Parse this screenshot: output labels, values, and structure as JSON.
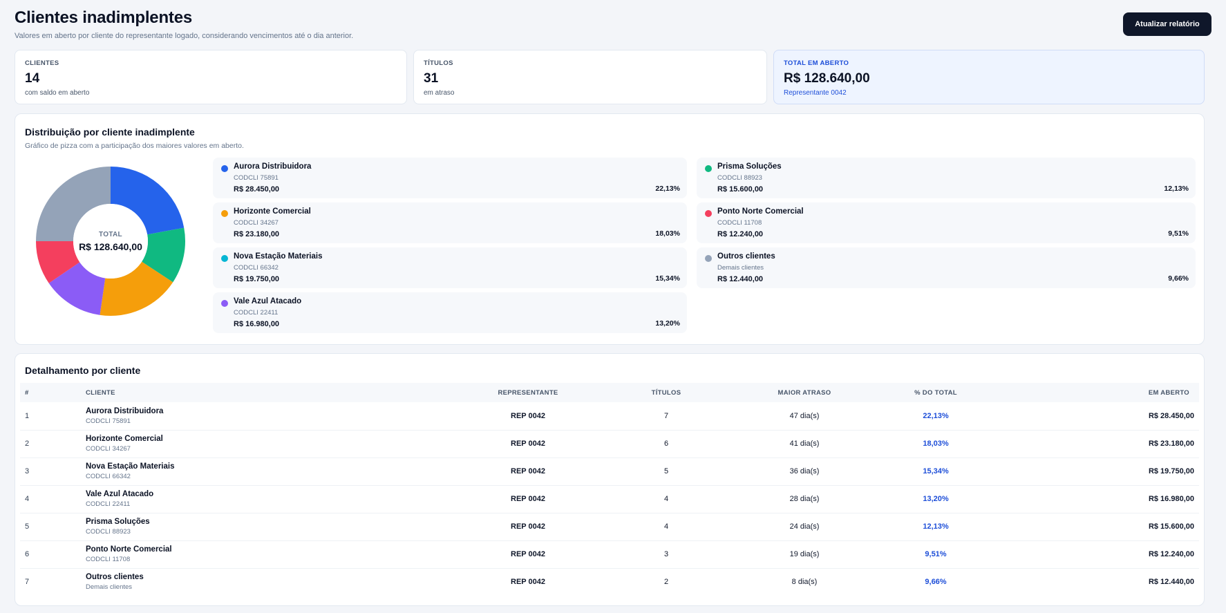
{
  "header": {
    "title": "Clientes inadimplentes",
    "subtitle": "Valores em aberto por cliente do representante logado, considerando vencimentos até o dia anterior.",
    "refresh_label": "Atualizar relatório"
  },
  "kpis": [
    {
      "label": "CLIENTES",
      "value": "14",
      "sub": "com saldo em aberto"
    },
    {
      "label": "TÍTULOS",
      "value": "31",
      "sub": "em atraso"
    },
    {
      "label": "TOTAL EM ABERTO",
      "value": "R$ 128.640,00",
      "sub": "Representante 0042"
    }
  ],
  "distribution": {
    "title": "Distribuição por cliente inadimplente",
    "subtitle": "Gráfico de pizza com a participação dos maiores valores em aberto.",
    "center_label": "TOTAL",
    "center_value": "R$ 128.640,00",
    "legend": [
      {
        "name": "Aurora Distribuidora",
        "code": "CODCLI 75891",
        "amount": "R$ 28.450,00",
        "pct": "22,13%",
        "color": "#2563eb"
      },
      {
        "name": "Prisma Soluções",
        "code": "CODCLI 88923",
        "amount": "R$ 15.600,00",
        "pct": "12,13%",
        "color": "#10b981"
      },
      {
        "name": "Horizonte Comercial",
        "code": "CODCLI 34267",
        "amount": "R$ 23.180,00",
        "pct": "18,03%",
        "color": "#f59e0b"
      },
      {
        "name": "Ponto Norte Comercial",
        "code": "CODCLI 11708",
        "amount": "R$ 12.240,00",
        "pct": "9,51%",
        "color": "#f43f5e"
      },
      {
        "name": "Nova Estação Materiais",
        "code": "CODCLI 66342",
        "amount": "R$ 19.750,00",
        "pct": "15,34%",
        "color": "#06b6d4"
      },
      {
        "name": "Outros clientes",
        "code": "Demais clientes",
        "amount": "R$ 12.440,00",
        "pct": "9,66%",
        "color": "#94a3b8"
      },
      {
        "name": "Vale Azul Atacado",
        "code": "CODCLI 22411",
        "amount": "R$ 16.980,00",
        "pct": "13,20%",
        "color": "#8b5cf6"
      }
    ]
  },
  "chart_data": {
    "type": "pie",
    "categories": [
      "Aurora Distribuidora",
      "Prisma Soluções",
      "Horizonte Comercial",
      "Vale Azul Atacado",
      "Ponto Norte Comercial",
      "Outros clientes"
    ],
    "values": [
      22.13,
      12.13,
      18.03,
      13.2,
      9.51,
      25.0
    ],
    "colors": [
      "#2563eb",
      "#10b981",
      "#f59e0b",
      "#8b5cf6",
      "#f43f5e",
      "#94a3b8"
    ]
  },
  "detail": {
    "title": "Detalhamento por cliente",
    "columns": [
      "#",
      "CLIENTE",
      "REPRESENTANTE",
      "TÍTULOS",
      "MAIOR ATRASO",
      "% DO TOTAL",
      "EM ABERTO"
    ],
    "rows": [
      {
        "idx": "1",
        "name": "Aurora Distribuidora",
        "code": "CODCLI 75891",
        "rep": "REP 0042",
        "titulos": "7",
        "atraso": "47 dia(s)",
        "pct": "22,13%",
        "aberto": "R$ 28.450,00"
      },
      {
        "idx": "2",
        "name": "Horizonte Comercial",
        "code": "CODCLI 34267",
        "rep": "REP 0042",
        "titulos": "6",
        "atraso": "41 dia(s)",
        "pct": "18,03%",
        "aberto": "R$ 23.180,00"
      },
      {
        "idx": "3",
        "name": "Nova Estação Materiais",
        "code": "CODCLI 66342",
        "rep": "REP 0042",
        "titulos": "5",
        "atraso": "36 dia(s)",
        "pct": "15,34%",
        "aberto": "R$ 19.750,00"
      },
      {
        "idx": "4",
        "name": "Vale Azul Atacado",
        "code": "CODCLI 22411",
        "rep": "REP 0042",
        "titulos": "4",
        "atraso": "28 dia(s)",
        "pct": "13,20%",
        "aberto": "R$ 16.980,00"
      },
      {
        "idx": "5",
        "name": "Prisma Soluções",
        "code": "CODCLI 88923",
        "rep": "REP 0042",
        "titulos": "4",
        "atraso": "24 dia(s)",
        "pct": "12,13%",
        "aberto": "R$ 15.600,00"
      },
      {
        "idx": "6",
        "name": "Ponto Norte Comercial",
        "code": "CODCLI 11708",
        "rep": "REP 0042",
        "titulos": "3",
        "atraso": "19 dia(s)",
        "pct": "9,51%",
        "aberto": "R$ 12.240,00"
      },
      {
        "idx": "7",
        "name": "Outros clientes",
        "code": "Demais clientes",
        "rep": "REP 0042",
        "titulos": "2",
        "atraso": "8 dia(s)",
        "pct": "9,66%",
        "aberto": "R$ 12.440,00"
      }
    ]
  }
}
